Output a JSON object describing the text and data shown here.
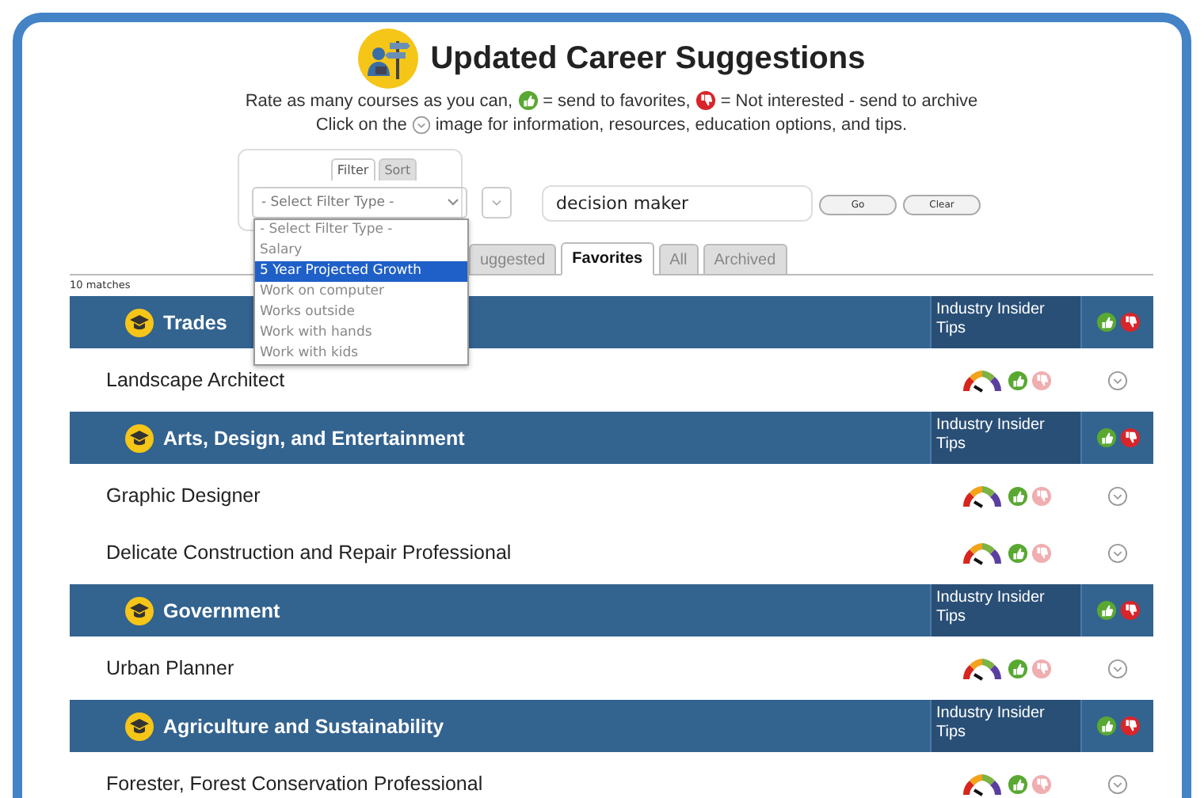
{
  "title": "Updated Career Suggestions",
  "instructions": {
    "line_1_before": "Rate as many courses as you can,",
    "line_1_middle": "= send to favorites,",
    "line_1_after": "= Not interested - send to archive",
    "line_2_before": "Click on the",
    "line_2_after": "image for information, resources, education options, and tips."
  },
  "filter_panel": {
    "tabs": [
      {
        "label": "Filter",
        "selected": true
      },
      {
        "label": "Sort",
        "selected": false
      }
    ],
    "select": {
      "value": "- Select Filter Type -",
      "options": [
        {
          "label": "- Select Filter Type -",
          "highlighted": false
        },
        {
          "label": "Salary",
          "highlighted": false
        },
        {
          "label": "5 Year Projected Growth",
          "highlighted": true
        },
        {
          "label": "Work on computer",
          "highlighted": false
        },
        {
          "label": "Works outside",
          "highlighted": false
        },
        {
          "label": "Work with hands",
          "highlighted": false
        },
        {
          "label": "Work with kids",
          "highlighted": false
        }
      ]
    }
  },
  "search": {
    "value": "decision maker"
  },
  "buttons": [
    "Go",
    "Clear"
  ],
  "tabs": [
    {
      "label": "uggested",
      "selected": false
    },
    {
      "label": "Favorites",
      "selected": true
    },
    {
      "label": "All",
      "selected": false
    },
    {
      "label": "Archived",
      "selected": false
    }
  ],
  "match_count": "10 matches",
  "categories": [
    {
      "name": "Trades",
      "tips_label": "Industry Insider Tips",
      "careers": [
        {
          "name": "Landscape Architect",
          "favorited": true
        }
      ]
    },
    {
      "name": "Arts, Design, and Entertainment",
      "tips_label": "Industry Insider Tips",
      "careers": [
        {
          "name": "Graphic Designer",
          "favorited": true
        },
        {
          "name": "Delicate Construction and Repair Professional",
          "favorited": true
        }
      ]
    },
    {
      "name": "Government",
      "tips_label": "Industry Insider Tips",
      "careers": [
        {
          "name": "Urban Planner",
          "favorited": true
        }
      ]
    },
    {
      "name": "Agriculture and Sustainability",
      "tips_label": "Industry Insider Tips",
      "careers": [
        {
          "name": "Forester, Forest Conservation Professional",
          "favorited": true
        }
      ]
    }
  ]
}
